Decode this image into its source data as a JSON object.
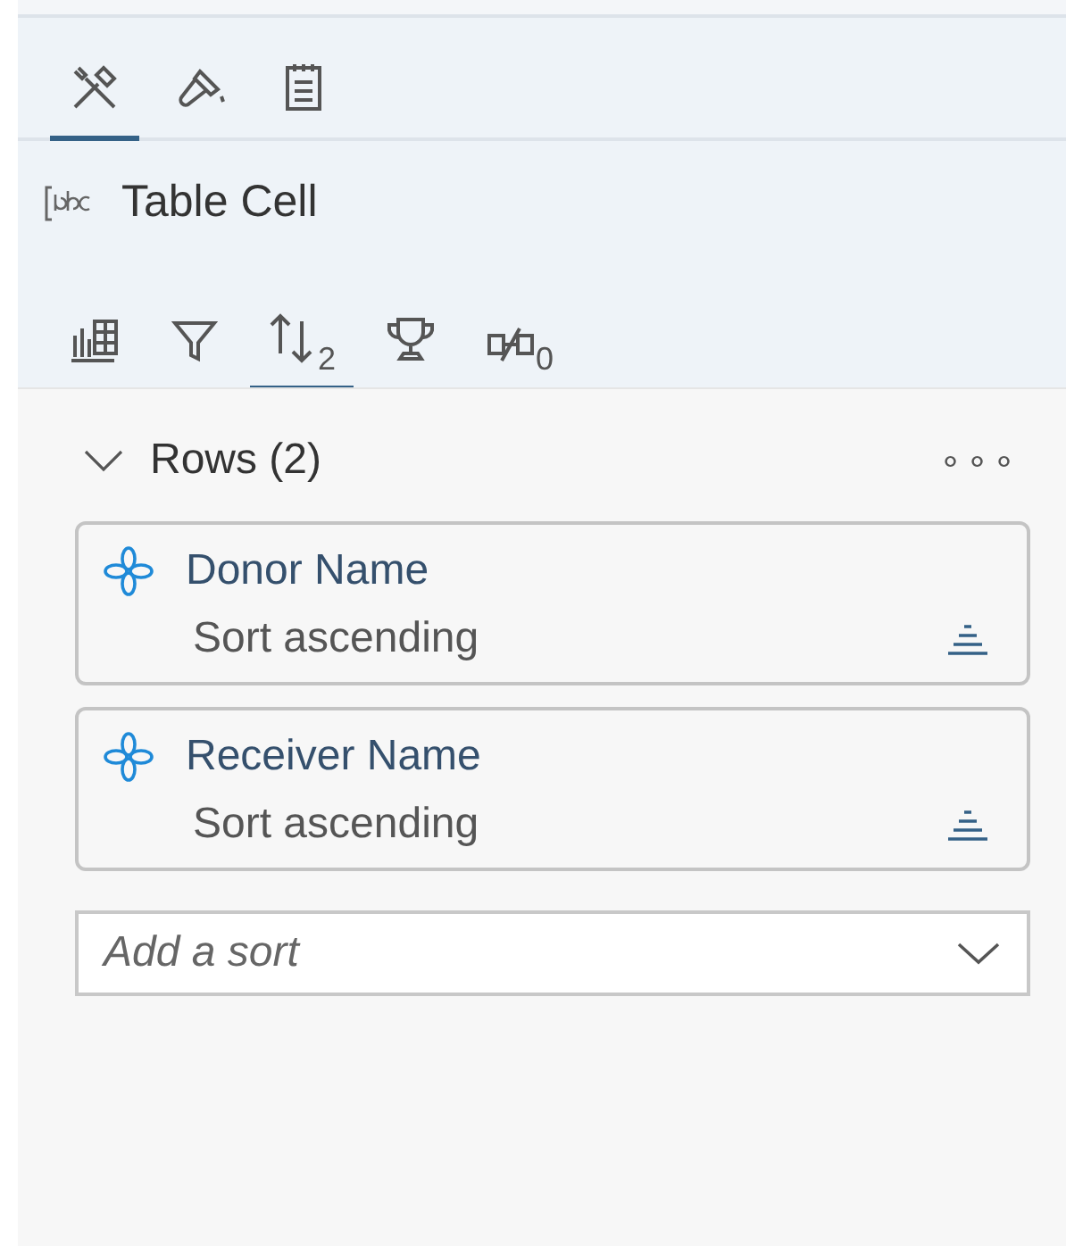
{
  "top_tabs": [
    {
      "kind": "tools",
      "selected": true
    },
    {
      "kind": "brush",
      "selected": false
    },
    {
      "kind": "notes",
      "selected": false
    }
  ],
  "context": {
    "label": "Table Cell"
  },
  "sub_tabs": [
    {
      "kind": "chart",
      "selected": false
    },
    {
      "kind": "filter",
      "selected": false
    },
    {
      "kind": "sort",
      "selected": true,
      "count": "2"
    },
    {
      "kind": "rank",
      "selected": false
    },
    {
      "kind": "compare",
      "selected": false,
      "count": "0"
    }
  ],
  "section": {
    "title": "Rows (2)",
    "expanded": true,
    "more": "∘∘∘"
  },
  "sorts": [
    {
      "name": "Donor Name",
      "order": "Sort ascending"
    },
    {
      "name": "Receiver Name",
      "order": "Sort ascending"
    }
  ],
  "add_sort": {
    "placeholder": "Add a sort"
  }
}
